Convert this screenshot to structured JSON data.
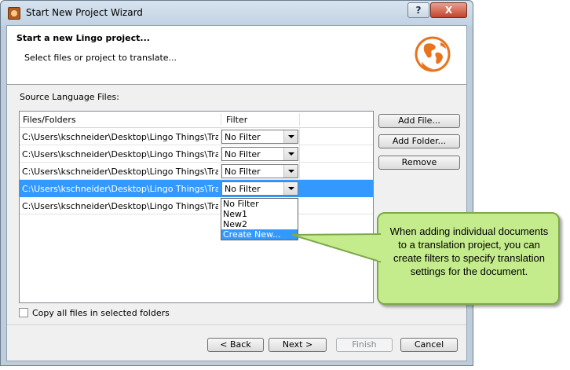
{
  "window": {
    "title": "Start New Project Wizard",
    "help_label": "?",
    "close_label": "X"
  },
  "header": {
    "heading": "Start a new Lingo project...",
    "subheading": "Select files or project to translate..."
  },
  "source_files": {
    "label": "Source Language Files:",
    "columns": [
      "Files/Folders",
      "Filter"
    ],
    "rows": [
      {
        "path": "C:\\Users\\kschneider\\Desktop\\Lingo Things\\Transl...",
        "filter": "No Filter",
        "selected": false
      },
      {
        "path": "C:\\Users\\kschneider\\Desktop\\Lingo Things\\Transl...",
        "filter": "No Filter",
        "selected": false
      },
      {
        "path": "C:\\Users\\kschneider\\Desktop\\Lingo Things\\Transl...",
        "filter": "No Filter",
        "selected": false
      },
      {
        "path": "C:\\Users\\kschneider\\Desktop\\Lingo Things\\Transl...",
        "filter": "No Filter",
        "selected": true
      },
      {
        "path": "C:\\Users\\kschneider\\Desktop\\Lingo Things\\Transl...",
        "filter": "",
        "selected": false
      }
    ],
    "filter_options": [
      "No Filter",
      "New1",
      "New2",
      "Create New..."
    ],
    "highlighted_option": "Create New..."
  },
  "side_buttons": {
    "add_file": "Add File...",
    "add_folder": "Add Folder...",
    "remove": "Remove"
  },
  "copy_folders": {
    "label": "Copy all files in selected folders",
    "checked": false
  },
  "footer": {
    "back": "< Back",
    "next": "Next >",
    "finish": "Finish",
    "cancel": "Cancel"
  },
  "callout": {
    "text": "When adding individual documents to a translation project, you can create filters to specify translation settings for the document."
  },
  "colors": {
    "selection": "#3399ff",
    "callout_fill": "#c4ec8c",
    "callout_border": "#7ea84c",
    "globe": "#e8741e"
  }
}
